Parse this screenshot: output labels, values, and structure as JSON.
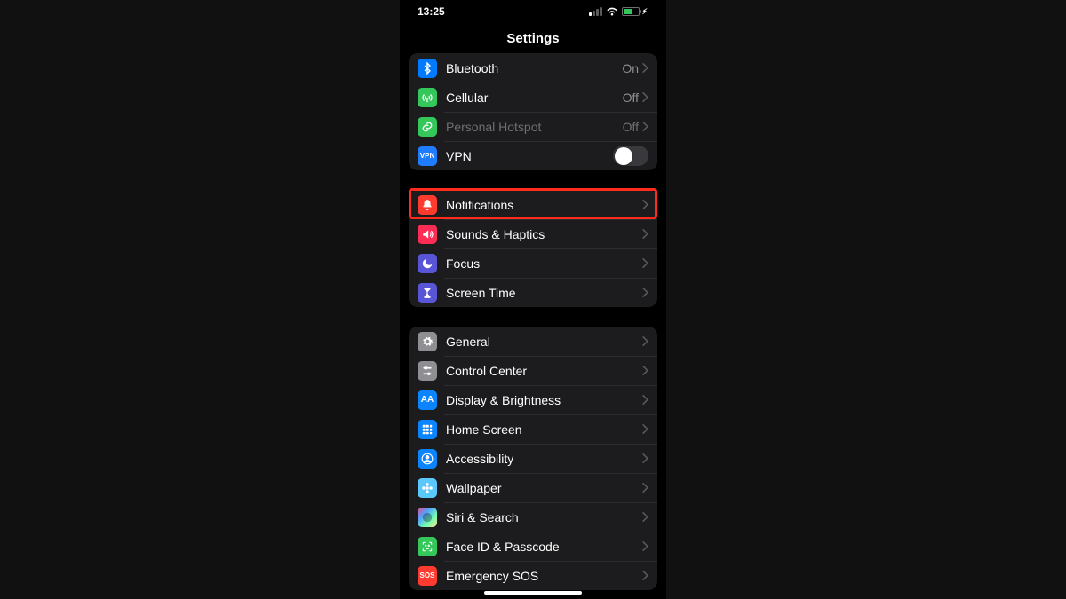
{
  "statusbar": {
    "time": "13:25"
  },
  "header": {
    "title": "Settings"
  },
  "groups": [
    {
      "rows": [
        {
          "id": "bluetooth",
          "label": "Bluetooth",
          "value": "On",
          "icon": "bluetooth",
          "color": "c-blue"
        },
        {
          "id": "cellular",
          "label": "Cellular",
          "value": "Off",
          "icon": "antenna",
          "color": "c-green"
        },
        {
          "id": "personal-hotspot",
          "label": "Personal Hotspot",
          "value": "Off",
          "icon": "link",
          "color": "c-green2",
          "dimmed": true
        },
        {
          "id": "vpn",
          "label": "VPN",
          "toggle": false,
          "icon": "vpn",
          "color": "c-vpn"
        }
      ]
    },
    {
      "rows": [
        {
          "id": "notifications",
          "label": "Notifications",
          "icon": "bell",
          "color": "c-red",
          "highlighted": true
        },
        {
          "id": "sounds-haptics",
          "label": "Sounds & Haptics",
          "icon": "speaker",
          "color": "c-pink"
        },
        {
          "id": "focus",
          "label": "Focus",
          "icon": "moon",
          "color": "c-moon"
        },
        {
          "id": "screen-time",
          "label": "Screen Time",
          "icon": "hourglass",
          "color": "c-purple"
        }
      ]
    },
    {
      "rows": [
        {
          "id": "general",
          "label": "General",
          "icon": "gear",
          "color": "c-gray"
        },
        {
          "id": "control-center",
          "label": "Control Center",
          "icon": "sliders",
          "color": "c-gray"
        },
        {
          "id": "display-brightness",
          "label": "Display & Brightness",
          "icon": "aa",
          "color": "c-ablue"
        },
        {
          "id": "home-screen",
          "label": "Home Screen",
          "icon": "grid",
          "color": "c-dots"
        },
        {
          "id": "accessibility",
          "label": "Accessibility",
          "icon": "person",
          "color": "c-ablue"
        },
        {
          "id": "wallpaper",
          "label": "Wallpaper",
          "icon": "flower",
          "color": "c-sky"
        },
        {
          "id": "siri-search",
          "label": "Siri & Search",
          "icon": "siri",
          "color": "siri-grad"
        },
        {
          "id": "faceid-passcode",
          "label": "Face ID & Passcode",
          "icon": "face",
          "color": "c-green"
        },
        {
          "id": "emergency-sos",
          "label": "Emergency SOS",
          "icon": "sos",
          "color": "c-red"
        }
      ]
    }
  ]
}
